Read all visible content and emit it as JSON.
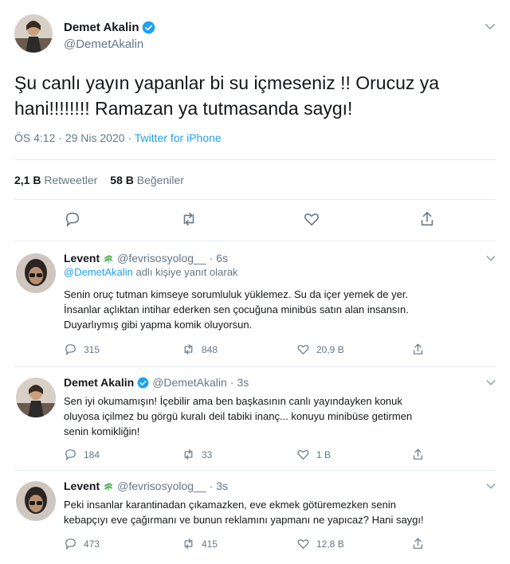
{
  "main_tweet": {
    "name": "Demet Akalin",
    "handle": "@DemetAkalin",
    "text_line1": "Şu canlı yayın yapanlar bi su içmeseniz !! Orucuz ya",
    "text_line2": "hani!!!!!!!! Ramazan ya tutmasanda saygı!",
    "time": "ÖS 4:12",
    "sep": "·",
    "date": "29 Nis 2020",
    "source": "Twitter for iPhone",
    "retweets_count": "2,1 B",
    "retweets_label": "Retweetler",
    "likes_count": "58 B",
    "likes_label": "Beğeniler"
  },
  "replies": [
    {
      "name": "Levent",
      "handle": "@fevrisosyolog__",
      "sep": "·",
      "time": "6s",
      "replying_mention": "@DemetAkalin",
      "replying_suffix": "adlı kişiye yanıt olarak",
      "lines": [
        "Senin oruç tutman kimseye sorumluluk yüklemez. Su da içer yemek de yer.",
        "İnsanlar açlıktan intihar ederken sen çocuğuna minibüs satın alan insansın.",
        "Duyarlıymış gibi yapma komik oluyorsun."
      ],
      "reply_count": "315",
      "retweet_count": "848",
      "like_count": "20,9 B"
    },
    {
      "name": "Demet Akalin",
      "handle": "@DemetAkalin",
      "sep": "·",
      "time": "3s",
      "lines": [
        "Sen iyi okumamışın! İçebilir ama ben başkasının canlı yayındayken konuk",
        "oluyosa içilmez bu görgü kuralı deil tabiki inanç... konuyu minibüse getirmen",
        "senin komikliğin!"
      ],
      "reply_count": "184",
      "retweet_count": "33",
      "like_count": "1 B"
    },
    {
      "name": "Levent",
      "handle": "@fevrisosyolog__",
      "sep": "·",
      "time": "3s",
      "lines": [
        "Peki insanlar karantinadan çıkamazken, eve ekmek götüremezken senin",
        "kebapçıyı eve çağırmanı ve bunun reklamını yapmanı ne yapıcaz? Hani saygı!"
      ],
      "reply_count": "473",
      "retweet_count": "415",
      "like_count": "12,8 B"
    }
  ],
  "colors": {
    "accent": "#1da1f2",
    "muted": "#657786",
    "text": "#14171a",
    "divider": "#e6ecf0"
  },
  "icons": {
    "reply": "speech-bubble-icon",
    "retweet": "retweet-arrows-icon",
    "like": "heart-icon",
    "share": "share-upload-icon",
    "verified": "verified-badge-icon",
    "caret": "chevron-down-icon",
    "herb": "herb-emoji-icon"
  }
}
